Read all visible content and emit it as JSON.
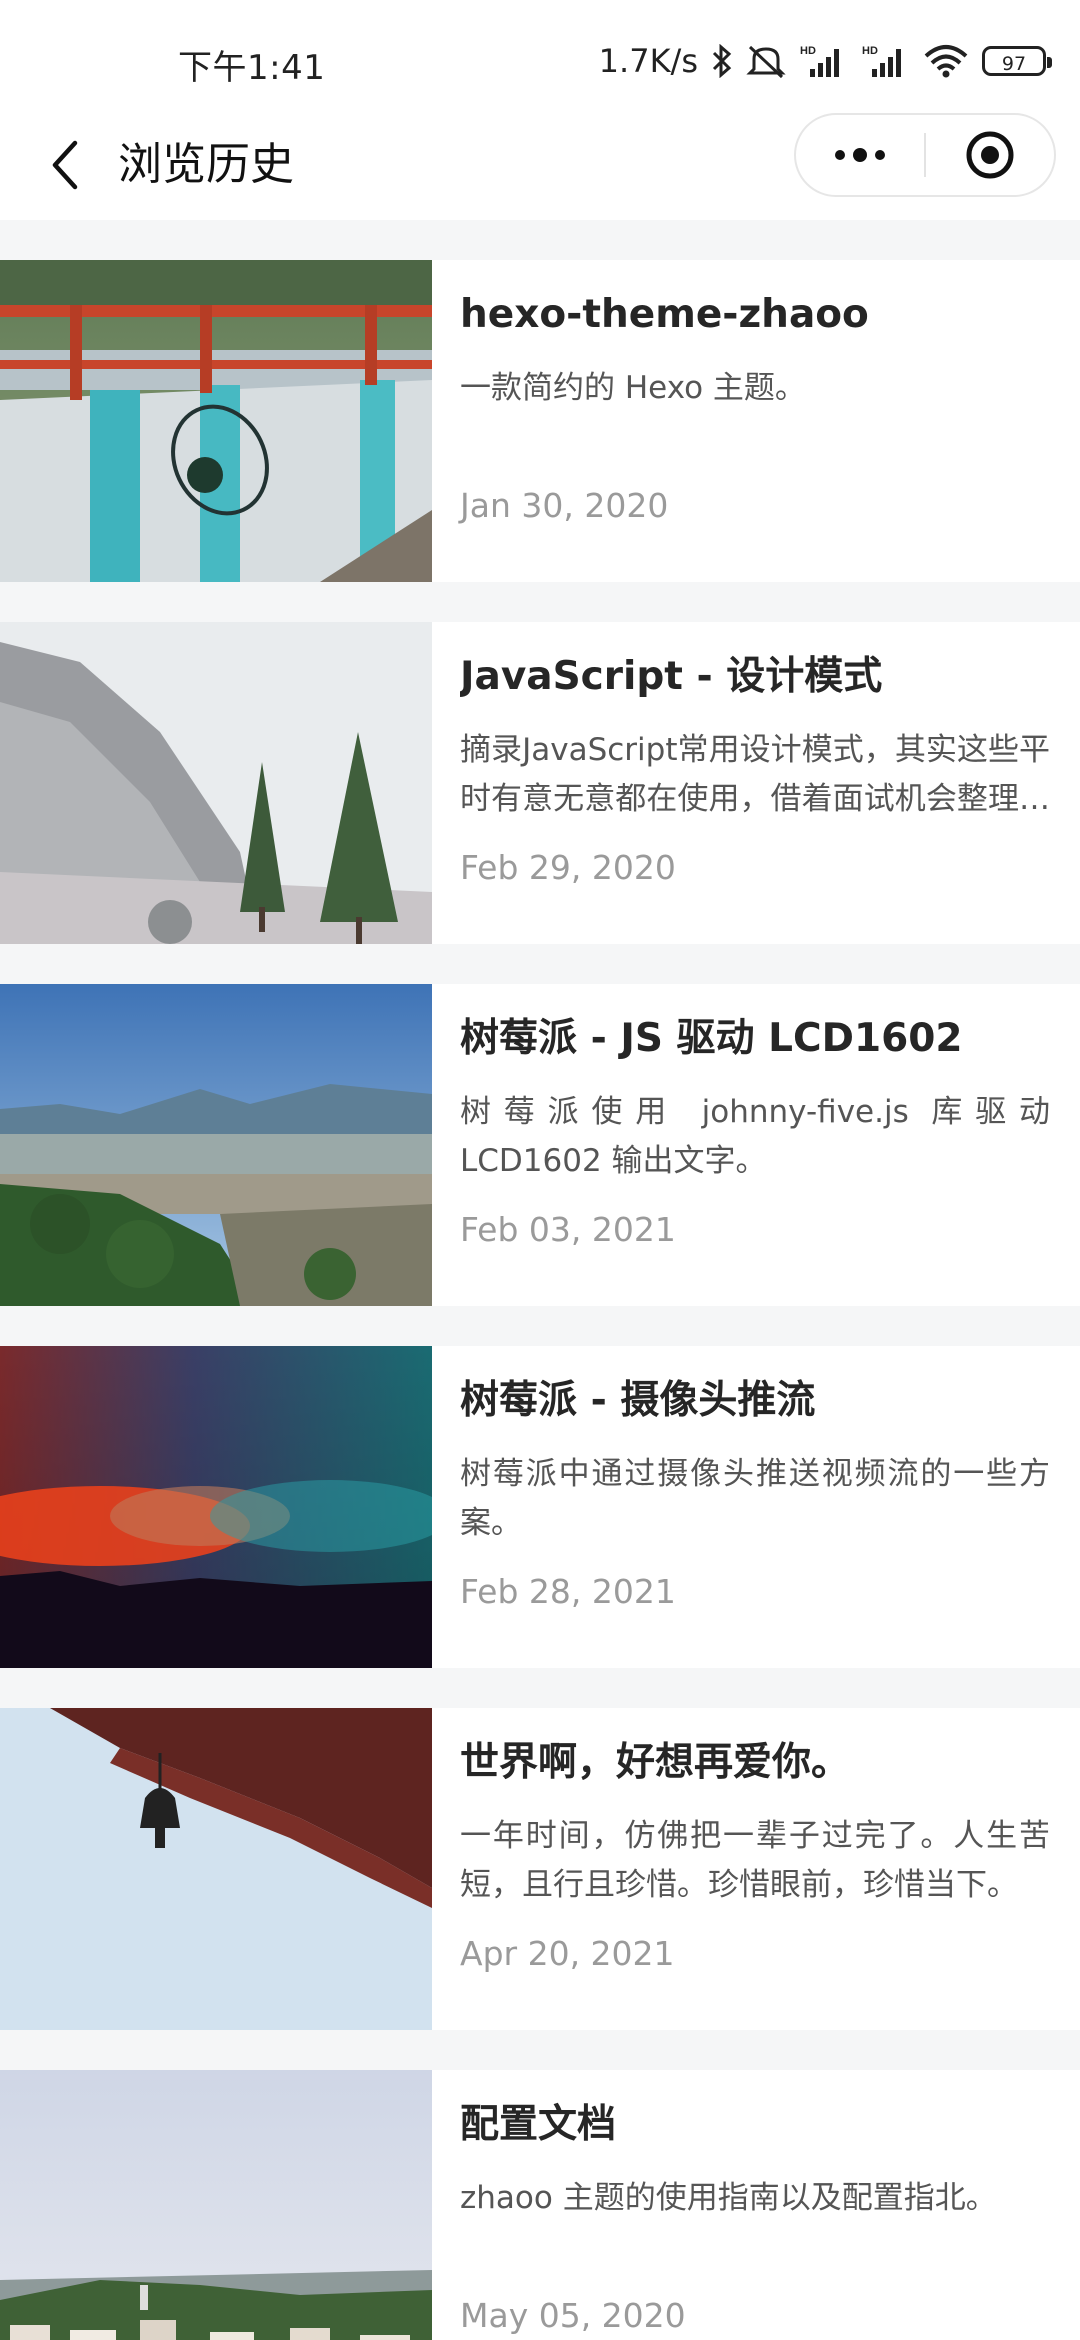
{
  "status_bar": {
    "time": "下午1:41",
    "network_speed": "1.7K/s",
    "battery": "97",
    "icons": [
      "bluetooth-icon",
      "mute-alarm-icon",
      "signal-hd-icon",
      "signal-hd-icon",
      "wifi-icon",
      "battery-icon"
    ]
  },
  "nav": {
    "title": "浏览历史",
    "back_icon": "chevron-left-icon",
    "more_icon": "more-dots-icon",
    "close_icon": "miniprogram-close-icon"
  },
  "articles": [
    {
      "title": "hexo-theme-zhaoo",
      "desc": "一款简约的 Hexo 主题。",
      "date": "Jan 30, 2020",
      "thumb": "railing-bridge-photo"
    },
    {
      "title": "JavaScript - 设计模式",
      "desc": "摘录JavaScript常用设计模式，其实这些平时有意无意都在使用，借着面试机会整理一下。",
      "date": "Feb 29, 2020",
      "thumb": "misty-mountain-photo"
    },
    {
      "title": "树莓派 - JS 驱动 LCD1602",
      "desc": "树莓派使用 johnny-five.js 库驱动 LCD1602 输出文字。",
      "date": "Feb 03, 2021",
      "thumb": "city-landscape-photo"
    },
    {
      "title": "树莓派 - 摄像头推流",
      "desc": "树莓派中通过摄像头推送视频流的一些方案。",
      "date": "Feb 28, 2021",
      "thumb": "sunset-gradient-photo"
    },
    {
      "title": "世界啊，好想再爱你。",
      "desc": "一年时间，仿佛把一辈子过完了。人生苦短，且行且珍惜。珍惜眼前，珍惜当下。",
      "date": "Apr 20, 2021",
      "thumb": "temple-bell-photo"
    },
    {
      "title": "配置文档",
      "desc": "zhaoo 主题的使用指南以及配置指北。",
      "date": "May 05, 2020",
      "thumb": "hillside-town-photo"
    }
  ],
  "colors": {
    "page_background": "#f5f6f7",
    "card_background": "#ffffff",
    "title_text": "#262626",
    "date_text": "#9a9a9a"
  }
}
